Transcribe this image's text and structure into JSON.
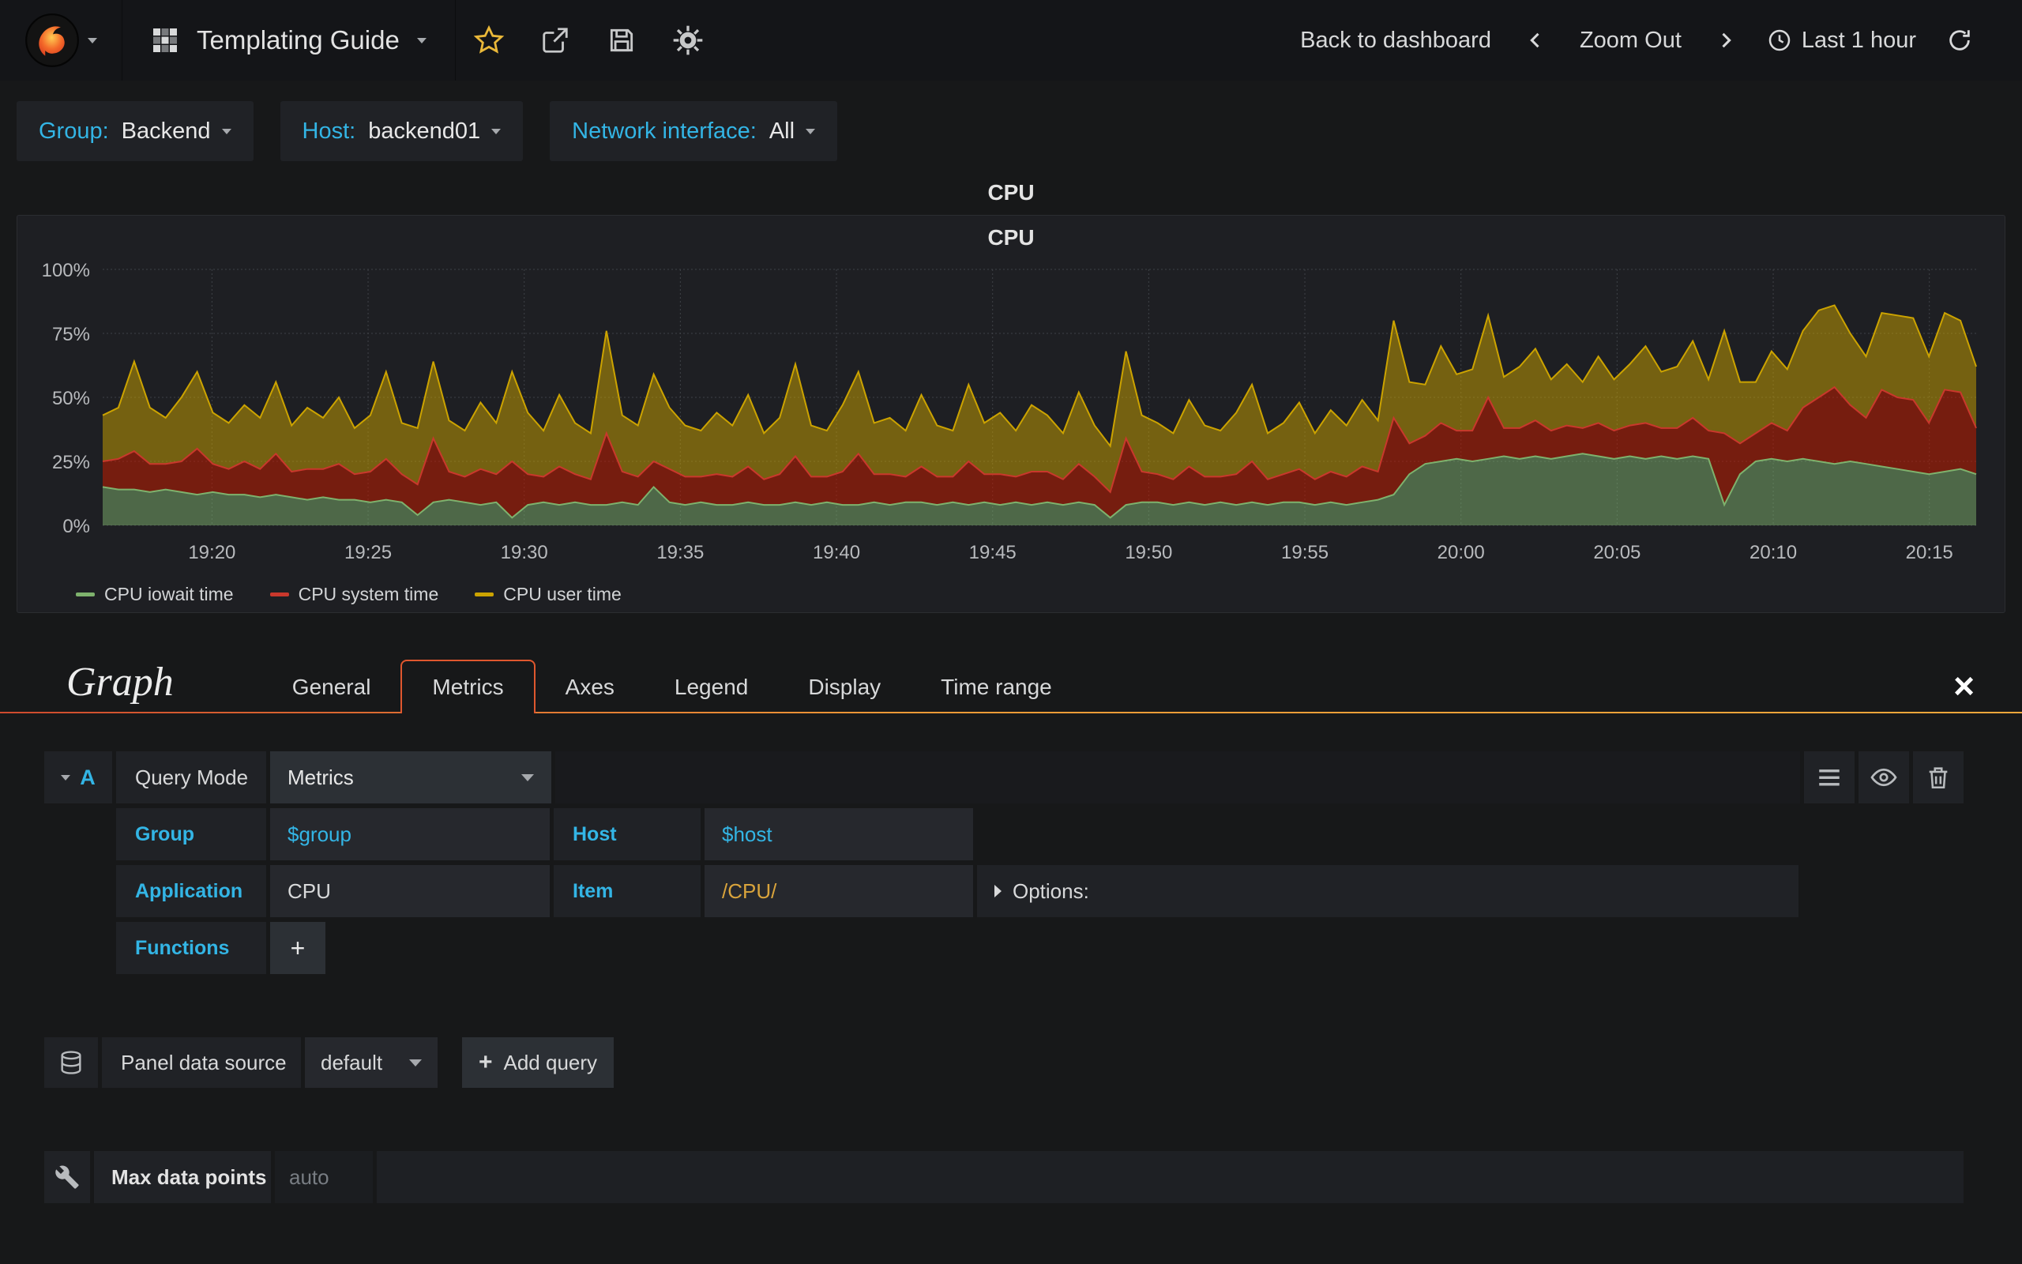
{
  "navbar": {
    "title": "Templating Guide",
    "back_to_dashboard": "Back to dashboard",
    "zoom_out": "Zoom Out",
    "time_range": "Last 1 hour"
  },
  "template_vars": [
    {
      "label": "Group:",
      "value": "Backend"
    },
    {
      "label": "Host:",
      "value": "backend01"
    },
    {
      "label": "Network interface:",
      "value": "All"
    }
  ],
  "panel": {
    "outer_title": "CPU",
    "title": "CPU"
  },
  "chart_data": {
    "type": "area",
    "stacked": true,
    "title": "CPU",
    "ylabel": "",
    "xlabel": "",
    "ylim": [
      0,
      100
    ],
    "yticks": [
      0,
      25,
      50,
      75,
      100
    ],
    "ytick_suffix": "%",
    "xticks": [
      "19:20",
      "19:25",
      "19:30",
      "19:35",
      "19:40",
      "19:45",
      "19:50",
      "19:55",
      "20:00",
      "20:05",
      "20:10",
      "20:15"
    ],
    "xtick_pos": [
      3.5,
      8.5,
      13.5,
      18.5,
      23.5,
      28.5,
      33.5,
      38.5,
      43.5,
      48.5,
      53.5,
      58.5
    ],
    "x_span": 60,
    "grid": true,
    "legend_position": "bottom-left",
    "series": [
      {
        "name": "CPU iowait time",
        "color": "#7eb26d",
        "fill": "rgba(126,178,109,0.5)",
        "values": [
          15,
          14,
          14,
          13,
          14,
          13,
          12,
          13,
          12,
          12,
          11,
          12,
          11,
          10,
          11,
          10,
          10,
          9,
          10,
          9,
          4,
          9,
          10,
          9,
          8,
          9,
          3,
          8,
          9,
          8,
          9,
          8,
          8,
          9,
          8,
          15,
          9,
          8,
          9,
          8,
          8,
          9,
          8,
          8,
          9,
          8,
          9,
          8,
          8,
          9,
          8,
          9,
          9,
          8,
          9,
          8,
          9,
          8,
          9,
          8,
          9,
          8,
          9,
          8,
          3,
          8,
          9,
          9,
          8,
          9,
          8,
          9,
          8,
          9,
          8,
          9,
          9,
          8,
          9,
          8,
          9,
          10,
          12,
          20,
          24,
          25,
          26,
          25,
          26,
          27,
          26,
          27,
          26,
          27,
          28,
          27,
          26,
          27,
          26,
          27,
          26,
          27,
          26,
          8,
          20,
          25,
          26,
          25,
          26,
          25,
          24,
          25,
          24,
          23,
          22,
          21,
          20,
          21,
          22,
          20
        ]
      },
      {
        "name": "CPU system time",
        "color": "#c9382c",
        "fill": "rgba(191,27,0,0.55)",
        "values": [
          10,
          12,
          15,
          11,
          10,
          12,
          18,
          11,
          10,
          13,
          11,
          16,
          10,
          12,
          11,
          14,
          10,
          12,
          16,
          11,
          12,
          25,
          11,
          10,
          14,
          11,
          22,
          12,
          10,
          15,
          11,
          10,
          28,
          12,
          11,
          10,
          13,
          11,
          10,
          12,
          11,
          14,
          10,
          12,
          18,
          11,
          10,
          13,
          20,
          11,
          12,
          10,
          14,
          11,
          10,
          17,
          11,
          12,
          10,
          13,
          12,
          10,
          15,
          11,
          10,
          26,
          12,
          11,
          10,
          14,
          11,
          10,
          12,
          16,
          10,
          11,
          13,
          10,
          12,
          11,
          14,
          11,
          30,
          12,
          11,
          15,
          11,
          12,
          24,
          11,
          12,
          14,
          11,
          12,
          10,
          13,
          11,
          12,
          14,
          11,
          12,
          15,
          11,
          28,
          12,
          11,
          14,
          12,
          20,
          25,
          30,
          22,
          18,
          30,
          28,
          28,
          20,
          32,
          30,
          18
        ]
      },
      {
        "name": "CPU user time",
        "color": "#cca300",
        "fill": "rgba(204,163,0,0.5)",
        "values": [
          18,
          20,
          35,
          22,
          18,
          25,
          30,
          20,
          18,
          22,
          20,
          28,
          18,
          24,
          20,
          26,
          18,
          22,
          34,
          20,
          22,
          30,
          20,
          18,
          26,
          20,
          35,
          24,
          18,
          28,
          20,
          18,
          40,
          22,
          20,
          34,
          24,
          20,
          18,
          24,
          20,
          28,
          18,
          22,
          36,
          20,
          18,
          26,
          32,
          20,
          22,
          18,
          28,
          20,
          18,
          30,
          20,
          24,
          18,
          26,
          22,
          18,
          28,
          20,
          18,
          34,
          22,
          20,
          18,
          26,
          20,
          18,
          24,
          30,
          18,
          20,
          26,
          18,
          24,
          20,
          26,
          20,
          38,
          24,
          20,
          30,
          22,
          24,
          32,
          20,
          24,
          28,
          20,
          24,
          18,
          26,
          20,
          24,
          30,
          22,
          24,
          30,
          20,
          40,
          24,
          20,
          28,
          24,
          30,
          34,
          32,
          28,
          24,
          30,
          32,
          32,
          26,
          30,
          28,
          24
        ]
      }
    ]
  },
  "editor": {
    "panel_type": "Graph",
    "tabs": [
      "General",
      "Metrics",
      "Axes",
      "Legend",
      "Display",
      "Time range"
    ],
    "active_tab": "Metrics",
    "close_label": "×",
    "query": {
      "ref_id": "A",
      "query_mode_label": "Query Mode",
      "query_mode_value": "Metrics",
      "group_label": "Group",
      "group_value": "$group",
      "host_label": "Host",
      "host_value": "$host",
      "application_label": "Application",
      "application_value": "CPU",
      "item_label": "Item",
      "item_value": "/CPU/",
      "options_label": "Options:",
      "functions_label": "Functions",
      "add_function_label": "+"
    },
    "datasource": {
      "label": "Panel data source",
      "value": "default",
      "add_query_label": "Add query",
      "add_query_plus": "+"
    },
    "max_data_points": {
      "label": "Max data points",
      "placeholder": "auto"
    }
  },
  "icons": {
    "navbar": [
      "grafana-logo",
      "dashboard-grid",
      "star",
      "share",
      "save",
      "settings",
      "chevron-left",
      "chevron-right",
      "clock",
      "refresh"
    ],
    "editor": [
      "collapse-caret",
      "menu",
      "eye",
      "trash",
      "plus",
      "database",
      "wrench",
      "close"
    ]
  },
  "colors": {
    "accent_cyan": "#33b5e5",
    "star_yellow": "#eab839",
    "tab_orange": "#df572e",
    "item_regex_gold": "#d9a43c",
    "page_bg": "#171819",
    "panel_bg": "#1e1f23",
    "cell_bg": "#202226"
  }
}
